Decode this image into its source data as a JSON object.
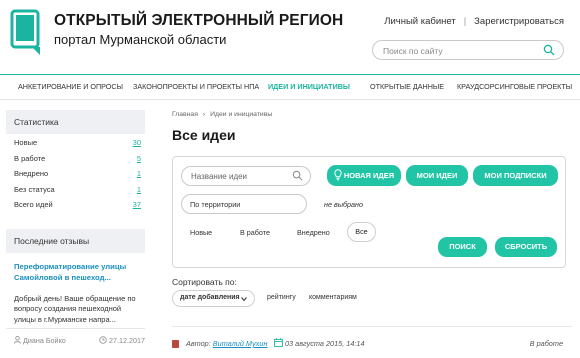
{
  "header": {
    "title": "ОТКРЫТЫЙ ЭЛЕКТРОННЫЙ РЕГИОН",
    "subtitle": "портал Мурманской области",
    "account_link": "Личный кабинет",
    "separator": "|",
    "register_link": "Зарегистрироваться",
    "search_placeholder": "Поиск по сайту"
  },
  "nav": {
    "items": [
      {
        "label": "АНКЕТИРОВАНИЕ И ОПРОСЫ"
      },
      {
        "label": "ЗАКОНОПРОЕКТЫ И ПРОЕКТЫ НПА"
      },
      {
        "label": "ИДЕИ И ИНИЦИАТИВЫ",
        "active": true
      },
      {
        "label": "ОТКРЫТЫЕ ДАННЫЕ"
      },
      {
        "label": "КРАУДСОРСИНГОВЫЕ ПРОЕКТЫ"
      }
    ]
  },
  "sidebar": {
    "stats_title": "Статистика",
    "stats": [
      {
        "label": "Новые",
        "value": "30"
      },
      {
        "label": "В работе",
        "value": "5"
      },
      {
        "label": "Внедрено",
        "value": "1"
      },
      {
        "label": "Без статуса",
        "value": "1"
      },
      {
        "label": "Всего идей",
        "value": "37"
      }
    ],
    "reviews_title": "Последние отзывы",
    "review": {
      "title": "Переформатирование улицы Самойловой в пешеход...",
      "text": "Добрый день! Ваше обращение по вопросу создания пешеходной улицы в  г.Мурманске напра...",
      "author": "Диана Бойко",
      "date": "27.12.2017"
    }
  },
  "main": {
    "breadcrumb": {
      "home": "Главная",
      "arrow": "›",
      "current": "Идеи и инициативы"
    },
    "title": "Все идеи",
    "filter": {
      "search_placeholder": "Название идеи",
      "new_idea": "НОВАЯ ИДЕЯ",
      "my_ideas": "МОИ ИДЕИ",
      "my_subscriptions": "МОИ ПОДПИСКИ",
      "territory_label": "По территории",
      "territory_value": "не выбрано",
      "statuses": [
        "Новые",
        "В работе",
        "Внедрено"
      ],
      "status_all": "Все",
      "search_button": "ПОИСК",
      "reset_button": "СБРОСИТЬ"
    },
    "sort": {
      "label": "Сортировать по:",
      "selected": "дате добавления",
      "options": [
        "рейтингу",
        "комментариям"
      ]
    },
    "idea": {
      "author_label": "Автор:",
      "author": "Виталий Мухин",
      "date": "03 августа 2015, 14:14",
      "status": "В работе"
    }
  },
  "colors": {
    "accent": "#22c4a6",
    "link": "#1a8fbf",
    "sidebar_head": "#eef0f3"
  }
}
